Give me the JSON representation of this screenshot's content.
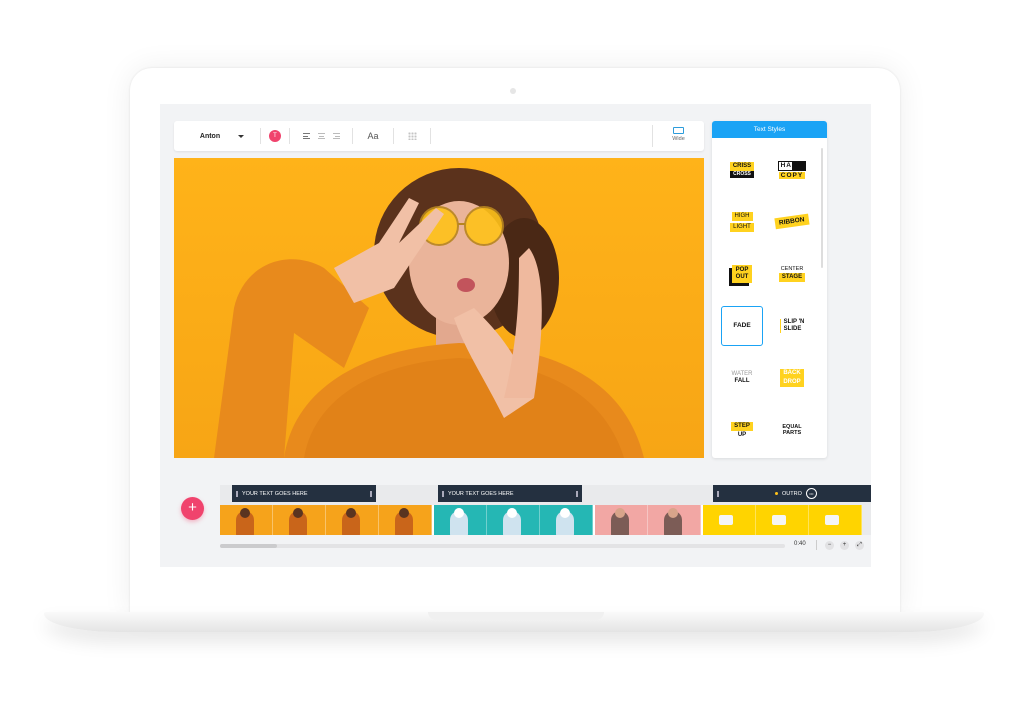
{
  "toolbar": {
    "font_name": "Anton",
    "color_badge": "T",
    "case_label": "Aa",
    "wide_label": "Wide"
  },
  "text_styles": {
    "title": "Text Styles",
    "items": [
      {
        "line1": "CRISS",
        "line2": "CROSS"
      },
      {
        "line1": "HARD",
        "line2": "COPY"
      },
      {
        "line1": "HIGH",
        "line2": "LIGHT"
      },
      {
        "line1": "RIBBON"
      },
      {
        "line1": "POP",
        "line2": "OUT"
      },
      {
        "line1": "CENTER",
        "line2": "STAGE"
      },
      {
        "line1": "FADE"
      },
      {
        "line1": "SLIP 'N",
        "line2": "SLIDE"
      },
      {
        "line1": "WATER",
        "line2": "FALL"
      },
      {
        "line1": "BACK",
        "line2": "DROP"
      },
      {
        "line1": "STEP",
        "line2": "UP"
      },
      {
        "line1": "EQUAL",
        "line2": "PARTS"
      }
    ],
    "selected": "FADE"
  },
  "timeline": {
    "add_label": "+",
    "text_clips": [
      {
        "label": "YOUR TEXT GOES HERE"
      },
      {
        "label": "YOUR TEXT GOES HERE"
      }
    ],
    "outro_label": "OUTRO",
    "time": "0:40"
  },
  "colors": {
    "accent_pink": "#f0436d",
    "accent_blue": "#1aa3f5",
    "photo_orange": "#ffb319",
    "highlight_yellow": "#ffd21f"
  }
}
